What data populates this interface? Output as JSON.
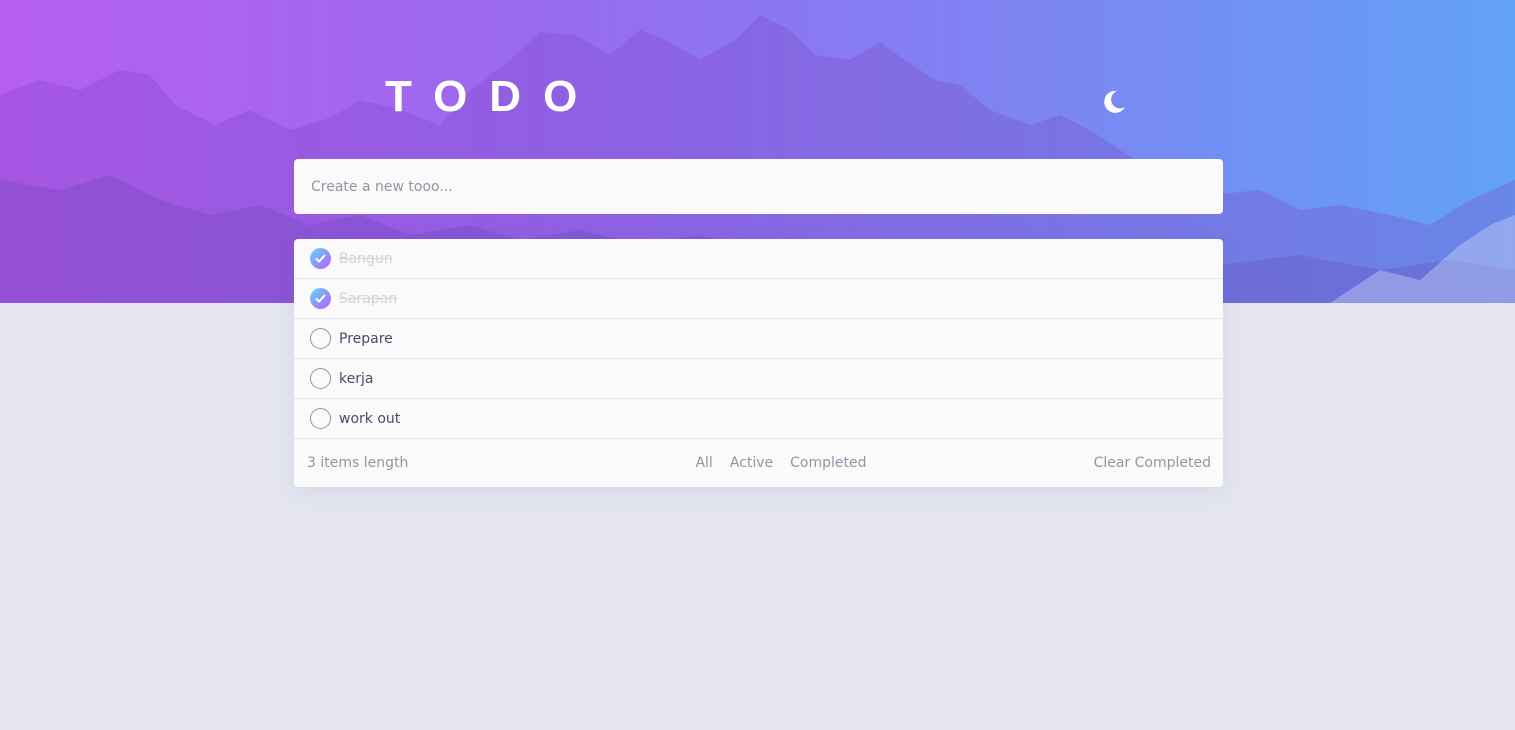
{
  "header": {
    "title": "TODO",
    "theme_toggle_icon": "moon-icon"
  },
  "new_todo": {
    "placeholder": "Create a new tooo...",
    "value": ""
  },
  "todos": [
    {
      "text": "Bangun",
      "completed": true
    },
    {
      "text": "Sarapan",
      "completed": true
    },
    {
      "text": "Prepare",
      "completed": false
    },
    {
      "text": "kerja",
      "completed": false
    },
    {
      "text": "work out",
      "completed": false
    }
  ],
  "footer": {
    "items_left": "3 items length",
    "filters": [
      "All",
      "Active",
      "Completed"
    ],
    "clear_label": "Clear Completed"
  },
  "colors": {
    "page_background": "#e4e5f1",
    "card_background": "#fafafa",
    "gradient_start": "#57ddff",
    "gradient_end": "#c058f3",
    "hero_left": "#b65ff0",
    "hero_right": "#62a2f6",
    "text_primary": "#494c6b",
    "text_muted": "#9394a5",
    "text_completed": "#d1d2da"
  }
}
